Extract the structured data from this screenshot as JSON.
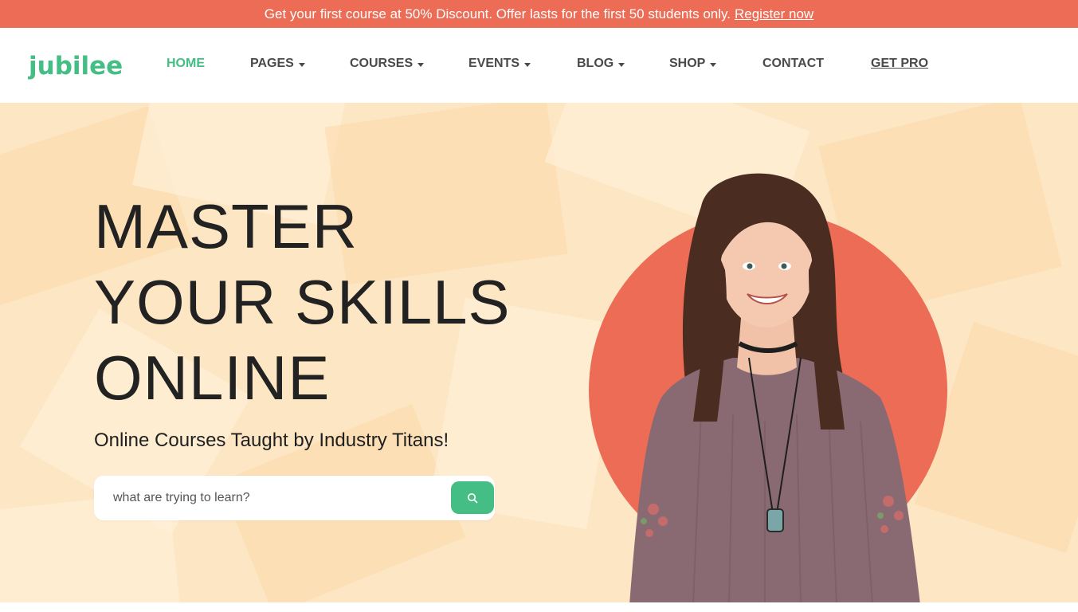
{
  "promo": {
    "text": "Get your first course at 50% Discount. Offer lasts for the first 50 students only.",
    "link_label": "Register now"
  },
  "brand": {
    "logo_text": "jubilee",
    "accent_color": "#45be85",
    "coral_color": "#ec6c56"
  },
  "nav": {
    "items": [
      {
        "label": "HOME",
        "dropdown": false,
        "active": true
      },
      {
        "label": "PAGES",
        "dropdown": true
      },
      {
        "label": "COURSES",
        "dropdown": true
      },
      {
        "label": "EVENTS",
        "dropdown": true
      },
      {
        "label": "BLOG",
        "dropdown": true
      },
      {
        "label": "SHOP",
        "dropdown": true
      },
      {
        "label": "CONTACT",
        "dropdown": false
      },
      {
        "label": "GET PRO",
        "dropdown": false
      }
    ]
  },
  "hero": {
    "headline_lines": [
      "MASTER",
      "YOUR SKILLS",
      "ONLINE"
    ],
    "subheadline": "Online Courses Taught by Industry Titans!",
    "search": {
      "placeholder": "what are trying to learn?",
      "value": "",
      "button_icon": "search-icon"
    },
    "image": "smiling-woman-portrait",
    "background_color": "#fde6c4"
  }
}
